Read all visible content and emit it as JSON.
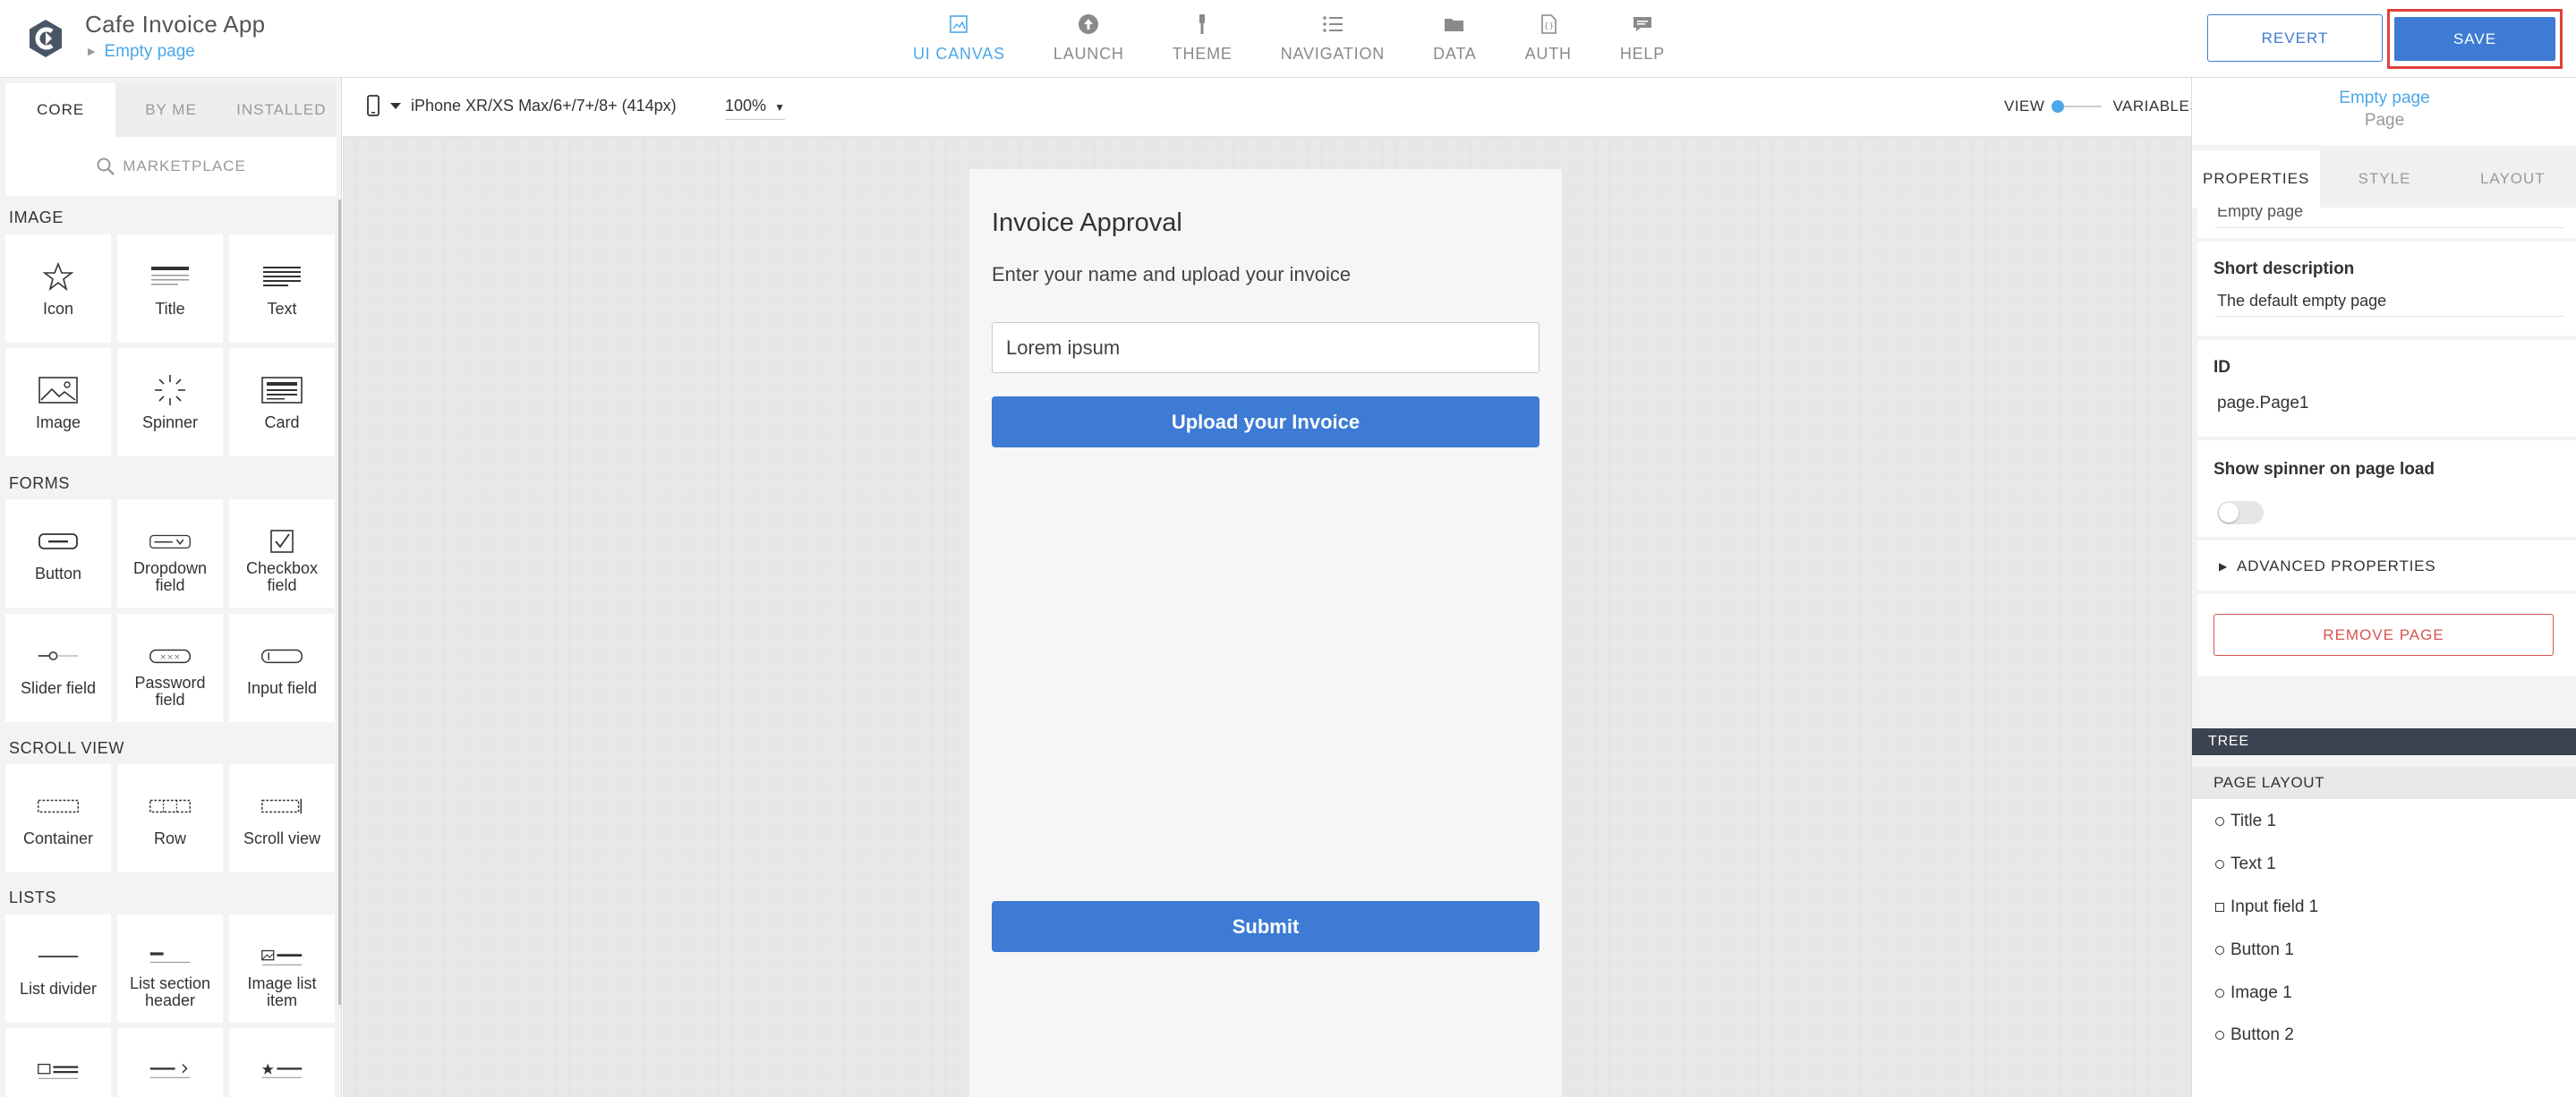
{
  "app": {
    "title": "Cafe Invoice App",
    "current_page": "Empty page"
  },
  "nav": {
    "items": [
      {
        "label": "UI CANVAS",
        "icon": "canvas-icon",
        "active": true
      },
      {
        "label": "LAUNCH",
        "icon": "launch-icon",
        "active": false
      },
      {
        "label": "THEME",
        "icon": "theme-icon",
        "active": false
      },
      {
        "label": "NAVIGATION",
        "icon": "navigation-icon",
        "active": false
      },
      {
        "label": "DATA",
        "icon": "data-icon",
        "active": false
      },
      {
        "label": "AUTH",
        "icon": "auth-icon",
        "active": false
      },
      {
        "label": "HELP",
        "icon": "help-icon",
        "active": false
      }
    ],
    "active_color": "#4ba8e8"
  },
  "actions": {
    "revert": "REVERT",
    "save": "SAVE",
    "primary_color": "#3d7bd4",
    "highlight_color": "#e0413a"
  },
  "library": {
    "tabs": [
      "CORE",
      "BY ME",
      "INSTALLED"
    ],
    "active_tab": "CORE",
    "marketplace": "MARKETPLACE",
    "sections": [
      {
        "title": "IMAGE",
        "items": [
          {
            "label": "Icon",
            "icon": "star-icon"
          },
          {
            "label": "Title",
            "icon": "title-icon"
          },
          {
            "label": "Text",
            "icon": "text-icon"
          },
          {
            "label": "Image",
            "icon": "image-icon"
          },
          {
            "label": "Spinner",
            "icon": "spinner-icon"
          },
          {
            "label": "Card",
            "icon": "card-icon"
          }
        ]
      },
      {
        "title": "FORMS",
        "items": [
          {
            "label": "Button",
            "icon": "button-icon"
          },
          {
            "label": "Dropdown field",
            "icon": "dropdown-icon"
          },
          {
            "label": "Checkbox field",
            "icon": "checkbox-icon"
          },
          {
            "label": "Slider field",
            "icon": "slider-icon"
          },
          {
            "label": "Password field",
            "icon": "password-icon"
          },
          {
            "label": "Input field",
            "icon": "input-icon"
          }
        ]
      },
      {
        "title": "SCROLL VIEW",
        "items": [
          {
            "label": "Container",
            "icon": "container-icon"
          },
          {
            "label": "Row",
            "icon": "row-icon"
          },
          {
            "label": "Scroll view",
            "icon": "scroll-view-icon"
          }
        ]
      },
      {
        "title": "LISTS",
        "items": [
          {
            "label": "List divider",
            "icon": "list-divider-icon"
          },
          {
            "label": "List section header",
            "icon": "list-section-header-icon"
          },
          {
            "label": "Image list item",
            "icon": "image-list-item-icon"
          },
          {
            "label": "",
            "icon": "image-list-row-icon"
          },
          {
            "label": "",
            "icon": "list-arrow-icon"
          },
          {
            "label": "",
            "icon": "list-star-icon"
          }
        ]
      }
    ]
  },
  "canvas_toolbar": {
    "device": "iPhone XR/XS Max/6+/7+/8+ (414px)",
    "zoom": "100%",
    "view_label": "VIEW",
    "variables_label": "VARIABLES"
  },
  "preview": {
    "title": "Invoice Approval",
    "text": "Enter your name and upload your invoice",
    "input_value": "Lorem ipsum",
    "upload_button": "Upload your Invoice",
    "submit_button": "Submit"
  },
  "properties": {
    "page_name": "Empty page",
    "page_type": "Page",
    "tabs": [
      "PROPERTIES",
      "STYLE",
      "LAYOUT"
    ],
    "active_tab": "PROPERTIES",
    "name_value": "Empty page",
    "short_description_label": "Short description",
    "short_description_value": "The default empty page",
    "id_label": "ID",
    "id_value": "page.Page1",
    "spinner_label": "Show spinner on page load",
    "spinner_on": false,
    "advanced": "ADVANCED PROPERTIES",
    "remove": "REMOVE PAGE"
  },
  "tree": {
    "title": "TREE",
    "page_layout": "PAGE LAYOUT",
    "items": [
      {
        "label": "Title 1",
        "shape": "circle"
      },
      {
        "label": "Text 1",
        "shape": "circle"
      },
      {
        "label": "Input field 1",
        "shape": "square"
      },
      {
        "label": "Button 1",
        "shape": "circle"
      },
      {
        "label": "Image 1",
        "shape": "circle"
      },
      {
        "label": "Button 2",
        "shape": "circle"
      }
    ]
  }
}
